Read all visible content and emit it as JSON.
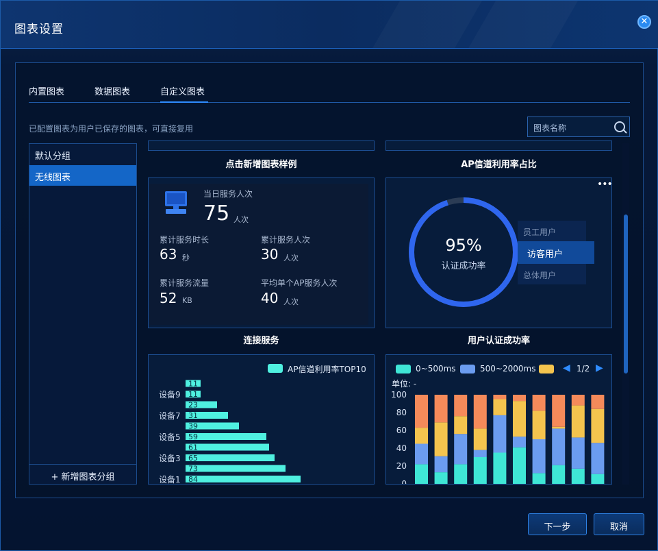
{
  "dialog": {
    "title": "图表设置",
    "close_icon": "close-icon"
  },
  "tabs": [
    {
      "label": "内置图表"
    },
    {
      "label": "数据图表"
    },
    {
      "label": "自定义图表"
    }
  ],
  "hint": "已配置图表为用户已保存的图表，可直接复用",
  "search": {
    "placeholder": "图表名称"
  },
  "sidebar": {
    "items": [
      {
        "label": "默认分组"
      },
      {
        "label": "无线图表"
      }
    ],
    "add_label": "+ 新增图表分组"
  },
  "cards": {
    "sample": {
      "title": "点击新增图表样例",
      "today_label": "当日服务人次",
      "today_value": "75",
      "today_unit": "人次",
      "stats": [
        {
          "label": "累计服务时长",
          "value": "63",
          "unit": "秒"
        },
        {
          "label": "累计服务人次",
          "value": "30",
          "unit": "人次"
        },
        {
          "label": "累计服务流量",
          "value": "52",
          "unit": "KB"
        },
        {
          "label": "平均单个AP服务人次",
          "value": "40",
          "unit": "人次"
        }
      ]
    },
    "ratio": {
      "title": "AP信道利用率占比",
      "percent": "95%",
      "caption": "认证成功率",
      "ring_fraction": 0.95,
      "legend": [
        {
          "label": "员工用户"
        },
        {
          "label": "访客用户"
        },
        {
          "label": "总体用户"
        }
      ],
      "more_icon": "more-icon"
    },
    "connect": {
      "title": "连接服务",
      "legend": "AP信道利用率TOP10",
      "color": "#4ff0e0"
    },
    "auth": {
      "title": "用户认证成功率",
      "legend": [
        {
          "label": "0~500ms",
          "color": "#3fe6d6"
        },
        {
          "label": "500~2000ms",
          "color": "#6b9cf0"
        },
        {
          "label": "",
          "color": "#f4c44e"
        }
      ],
      "page": "1/2",
      "unit": "单位: -"
    }
  },
  "chart_data": [
    {
      "type": "bar",
      "orientation": "horizontal",
      "series": [
        {
          "name": "AP信道利用率TOP10",
          "values": [
            84,
            73,
            65,
            61,
            59,
            39,
            31,
            23,
            11,
            11
          ]
        }
      ],
      "categories": [
        "设备1",
        "",
        "设备3",
        "",
        "设备5",
        "",
        "设备7",
        "",
        "设备9",
        ""
      ],
      "xlim": [
        0,
        100
      ]
    },
    {
      "type": "bar",
      "stacked": true,
      "ylim": [
        0,
        100
      ],
      "yticks": [
        0,
        20,
        40,
        60,
        80,
        100
      ],
      "series": [
        {
          "name": "0~500ms",
          "color": "#3fe6d6",
          "values": [
            22,
            13,
            22,
            30,
            35,
            41,
            12,
            21,
            17,
            11
          ]
        },
        {
          "name": "500~2000ms",
          "color": "#6b9cf0",
          "values": [
            23,
            18,
            34,
            8,
            42,
            12,
            38,
            41,
            35,
            35
          ]
        },
        {
          "name": "",
          "color": "#f4c44e",
          "values": [
            18,
            38,
            20,
            24,
            18,
            40,
            32,
            2,
            36,
            38
          ]
        },
        {
          "name": "",
          "color": "#f58a5a",
          "values": [
            37,
            31,
            24,
            38,
            5,
            7,
            18,
            36,
            12,
            16
          ]
        }
      ]
    }
  ],
  "footer": {
    "next_label": "下一步",
    "cancel_label": "取消"
  }
}
